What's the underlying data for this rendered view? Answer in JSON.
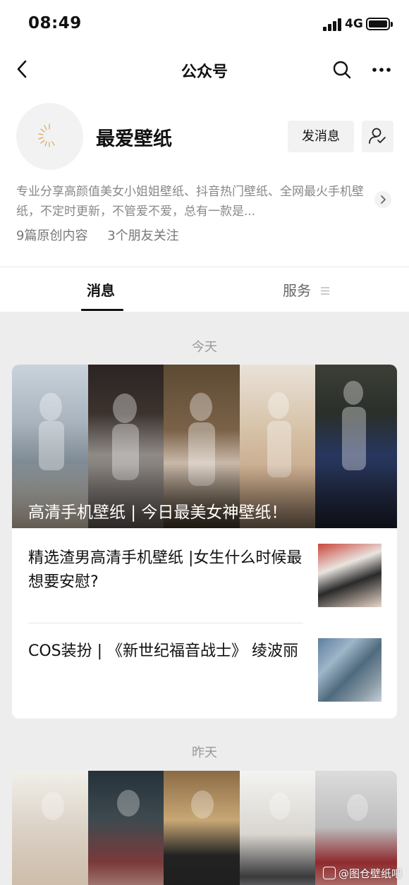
{
  "status_bar": {
    "time": "08:49",
    "network": "4G"
  },
  "nav": {
    "title": "公众号"
  },
  "profile": {
    "name": "最爱壁纸",
    "message_button": "发消息",
    "description": "专业分享高颜值美女小姐姐壁纸、抖音热门壁纸、全网最火手机壁纸，不定时更新，不管爱不爱，总有一款是...",
    "original_count": "9篇原创内容",
    "friends_following": "3个朋友关注"
  },
  "tabs": {
    "messages": "消息",
    "services": "服务"
  },
  "feed": [
    {
      "date": "今天",
      "cover_title": "高清手机壁纸 | 今日最美女神壁纸！",
      "articles": [
        {
          "title": "精选渣男高清手机壁纸 |女生什么时候最想要安慰?"
        },
        {
          "title": "COS装扮 | 《新世纪福音战士》 绫波丽"
        }
      ]
    },
    {
      "date": "昨天"
    }
  ],
  "watermark": "@图仓壁纸吧",
  "icons": {
    "back": "chevron-left-icon",
    "search": "search-icon",
    "more": "more-horizontal-icon",
    "follow": "user-check-icon",
    "expand": "chevron-right-icon",
    "services_menu": "menu-lines-icon"
  },
  "colors": {
    "secondary_text": "#888888",
    "tab_active": "#111111",
    "background": "#ededed"
  }
}
